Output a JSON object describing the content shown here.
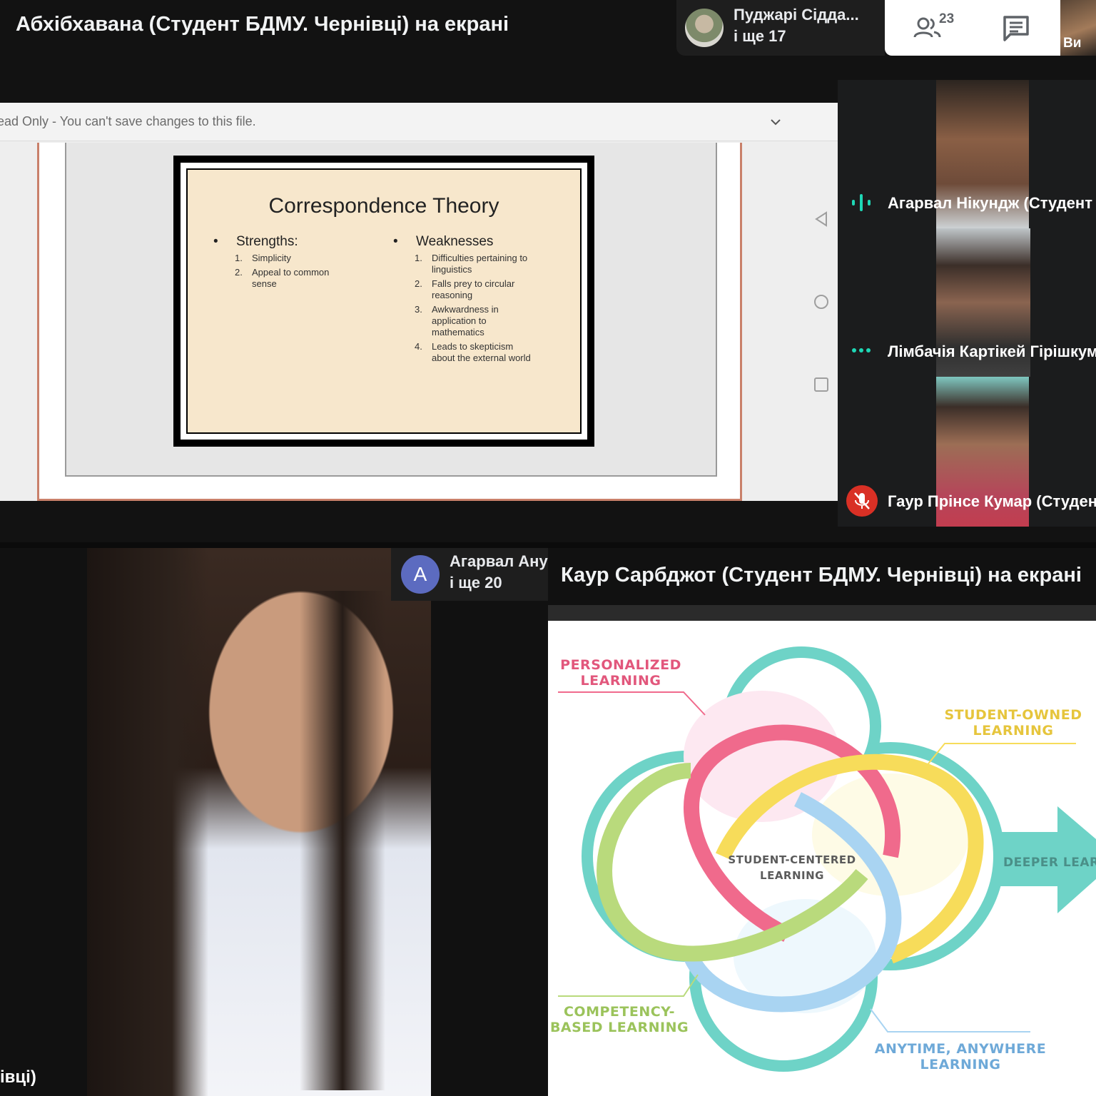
{
  "top": {
    "presenter_title": "Абхібхавана (Студент БДМУ. Чернівці) на екрані",
    "people_chip": {
      "line1": "Пуджарі Сідда...",
      "line2": "і ще 17"
    },
    "participants_count": "23",
    "self_label": "Ви",
    "shared_doc": {
      "readonly_message": "ead Only - You can't save changes to this file.",
      "slide": {
        "title": "Correspondence Theory",
        "strengths_head": "Strengths:",
        "strengths": [
          {
            "n": "1.",
            "text": "Simplicity"
          },
          {
            "n": "2.",
            "text": "Appeal to common sense"
          }
        ],
        "weaknesses_head": "Weaknesses",
        "weaknesses": [
          {
            "n": "1.",
            "text": "Difficulties pertaining to linguistics"
          },
          {
            "n": "2.",
            "text": "Falls prey to circular reasoning"
          },
          {
            "n": "3.",
            "text": "Awkwardness in application to mathematics"
          },
          {
            "n": "4.",
            "text": "Leads to skepticism about the external world"
          }
        ]
      }
    },
    "participants": [
      {
        "name": "Агарвал Нікундж (Студент",
        "status": "speaking"
      },
      {
        "name": "Лімбачія Картікей Гірішкум",
        "status": "more"
      },
      {
        "name": "Гаур Прінсе Кумар (Студен",
        "status": "muted"
      }
    ]
  },
  "bottom_left": {
    "chip_letter": "A",
    "chip_line1": "Агарвал Ану",
    "chip_line2": "і ще 20",
    "name_fragment": "івці)"
  },
  "bottom_right": {
    "presenter_title": "Каур Сарбджот (Студент БДМУ. Чернівці) на екрані",
    "diagram": {
      "personalized": [
        "PERSONALIZED",
        "LEARNING"
      ],
      "student_owned": [
        "STUDENT-OWNED",
        "LEARNING"
      ],
      "center": [
        "STUDENT-CENTERED",
        "LEARNING"
      ],
      "competency": [
        "COMPETENCY-",
        "BASED LEARNING"
      ],
      "anytime": [
        "ANYTIME, ANYWHERE",
        "LEARNING"
      ],
      "deeper": "DEEPER LEARNING"
    }
  },
  "colors": {
    "accent_teal": "#6ed3c7",
    "pink": "#f06a8c",
    "yellow": "#f7dc5a",
    "green": "#b9da7c",
    "blue": "#a9d4f2",
    "mute_red": "#d93025",
    "speaking": "#1ed7b5"
  }
}
